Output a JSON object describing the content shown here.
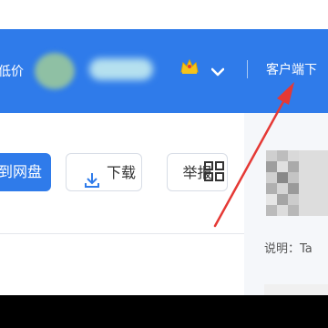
{
  "header": {
    "left_text": "低价",
    "right_text": "客户端下"
  },
  "actions": {
    "save_label": "到网盘",
    "download_label": "下载",
    "report_label": "举报"
  },
  "side": {
    "note_label": "说明：Ta"
  },
  "colors": {
    "brand": "#2f7bea",
    "annotation": "#e53935",
    "crown": "#f5c31b"
  },
  "icons": [
    "crown-icon",
    "chevron-down-icon",
    "download-icon",
    "grid-icon"
  ]
}
